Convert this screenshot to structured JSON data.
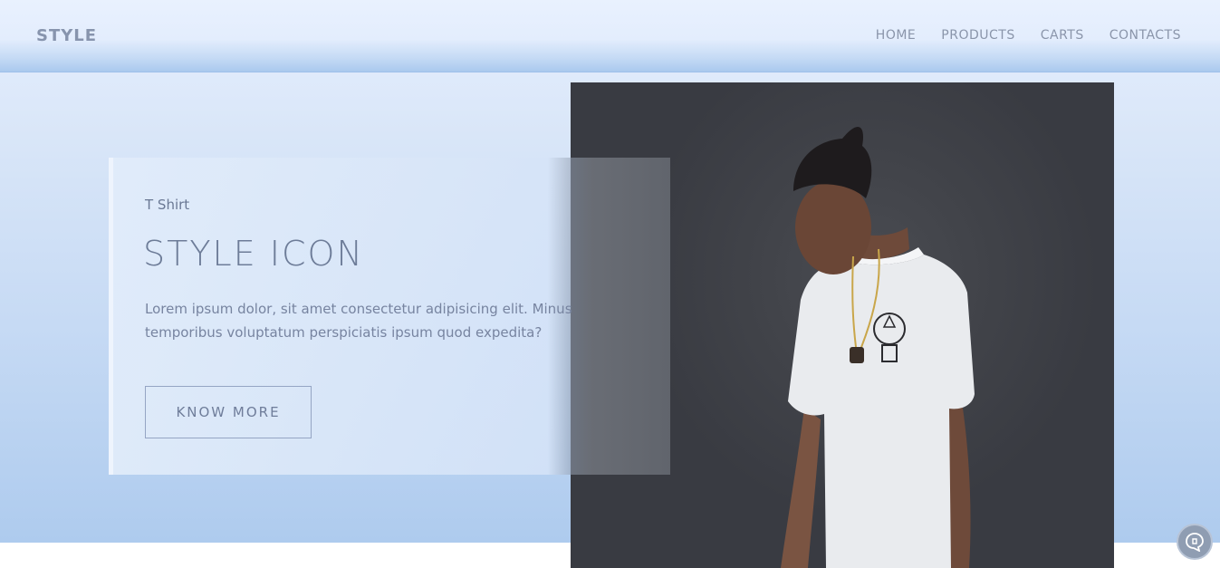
{
  "navbar": {
    "brand": "STYLE",
    "links": [
      "HOME",
      "PRODUCTS",
      "CARTS",
      "CONTACTS"
    ]
  },
  "hero": {
    "category": "T Shirt",
    "title": "STYLE ICON",
    "description": "Lorem ipsum dolor, sit amet consectetur adipisicing elit. Minus temporibus voluptatum perspiciatis ipsum quod expedita?",
    "button_label": "KNOW MORE",
    "photo_icon": "model-in-white-tshirt-photo"
  },
  "widget": {
    "icon": "chat-bubble-icon"
  },
  "colors": {
    "accent": "#6d7c98",
    "hero_top": "#e6efff",
    "hero_bottom": "#aecbee",
    "photo_dark": "#3b3d44"
  }
}
